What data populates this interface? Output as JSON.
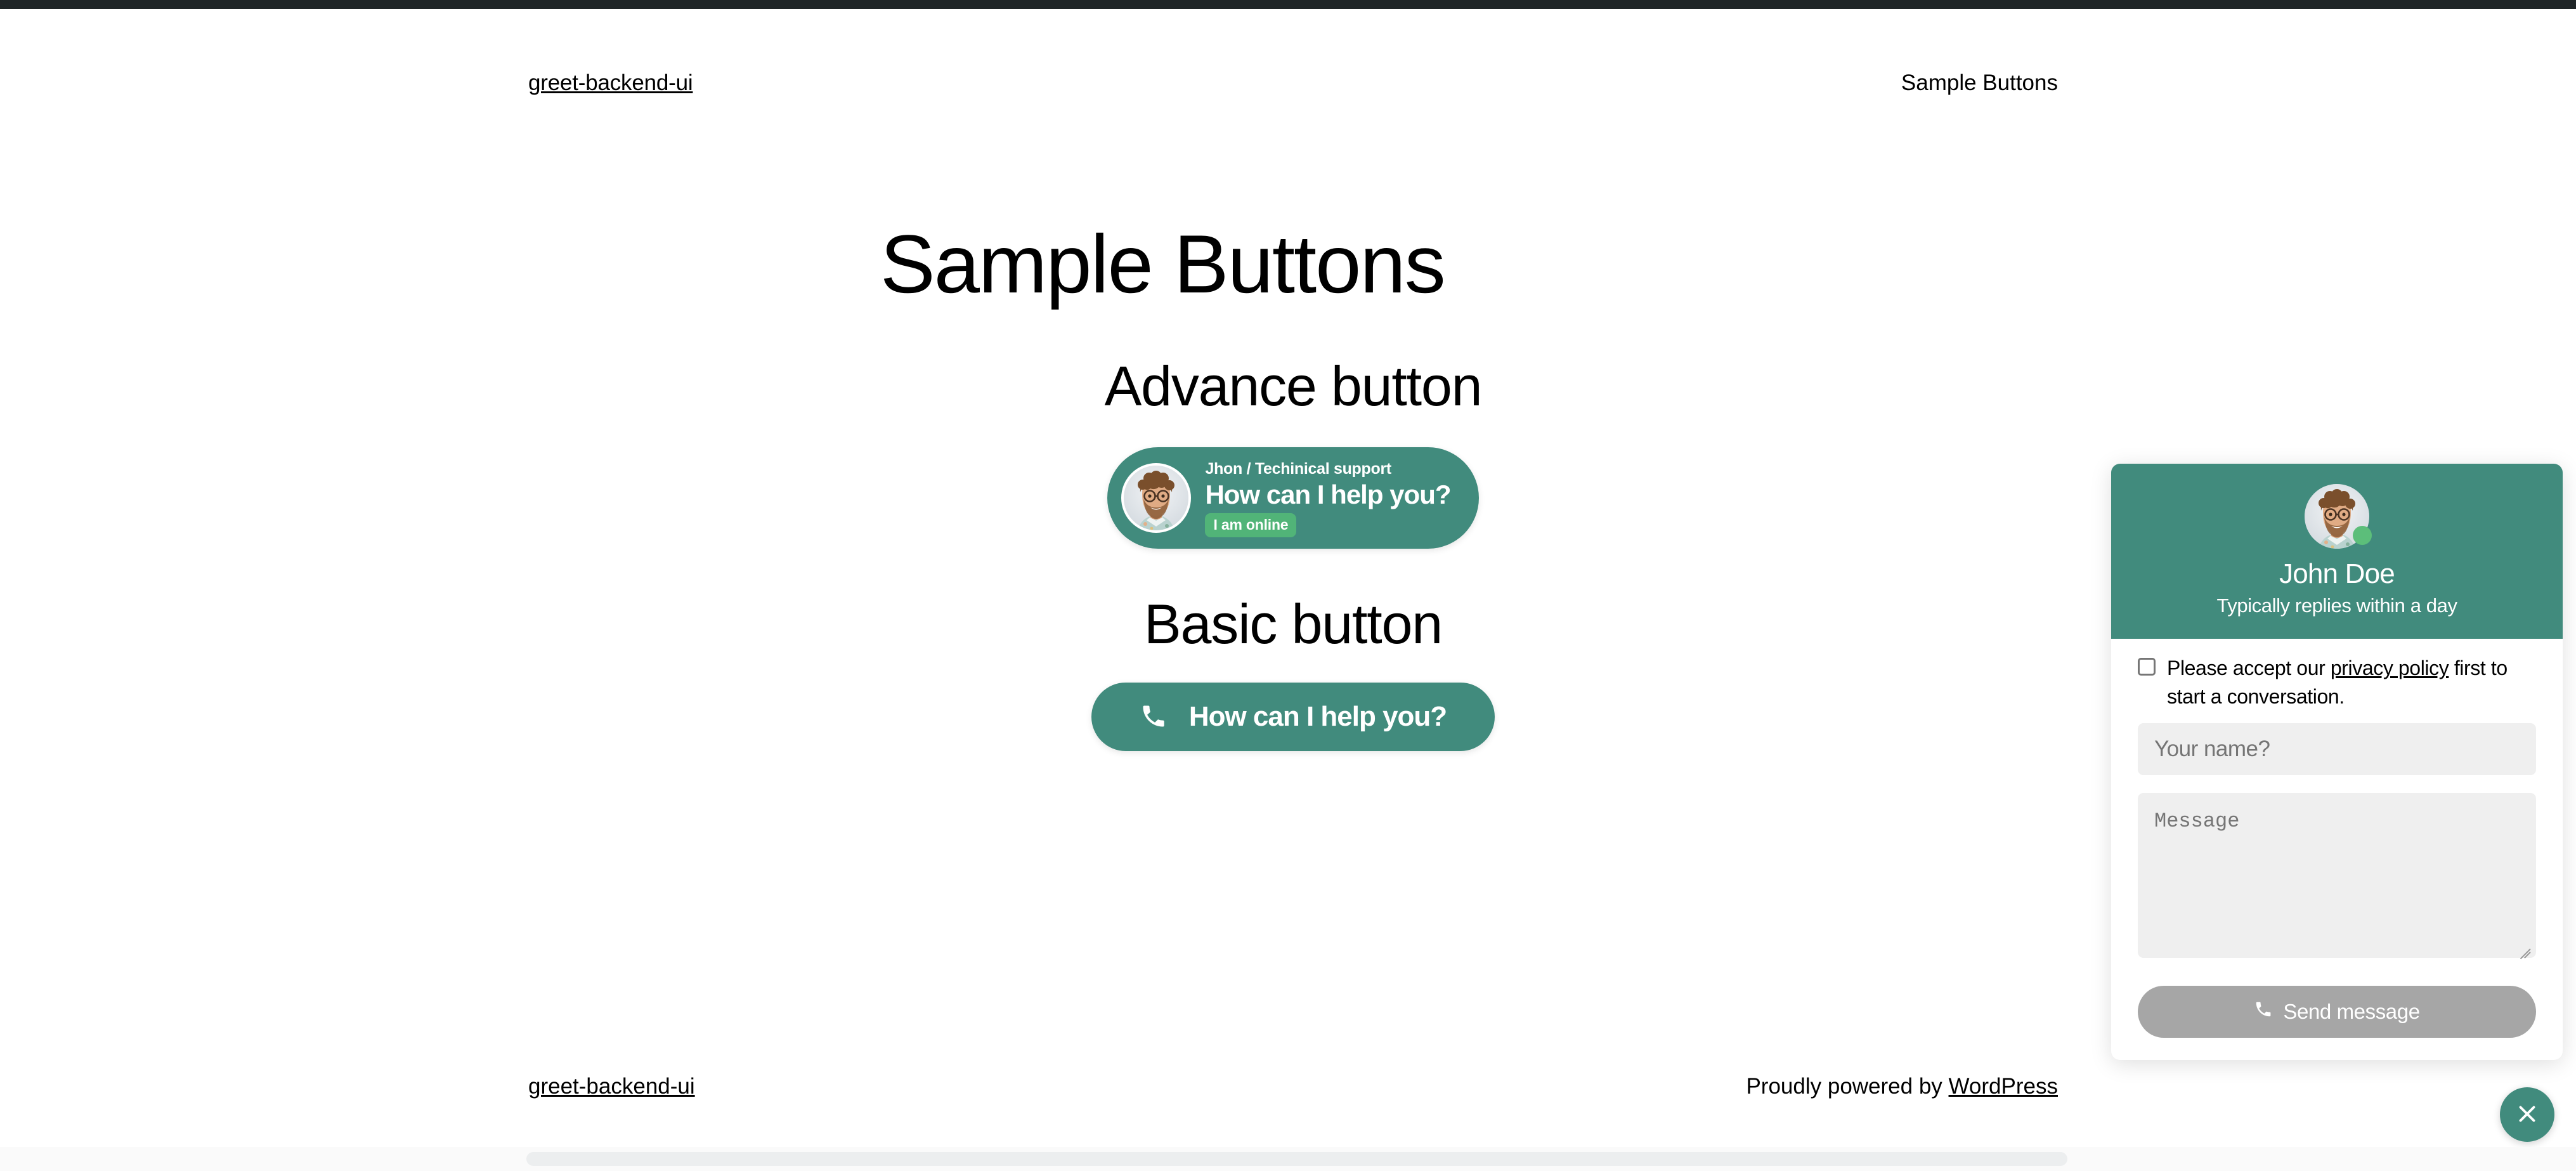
{
  "site": {
    "title": "greet-backend-ui",
    "nav_link": "Sample Buttons",
    "footer_title": "greet-backend-ui",
    "footer_credit_prefix": "Proudly powered by ",
    "footer_credit_link": "WordPress"
  },
  "main": {
    "page_title": "Sample Buttons",
    "sections": [
      {
        "heading": "Advance button"
      },
      {
        "heading": "Basic button"
      }
    ]
  },
  "advance_button": {
    "role": "Jhon / Techinical support",
    "message": "How can I help you?",
    "status_badge": "I am online",
    "avatar_icon": "agent-avatar-photo",
    "background_color": "#418b7d",
    "badge_color": "#51b478"
  },
  "basic_button": {
    "label": "How can I help you?",
    "icon": "phone-icon",
    "background_color": "#418b7d"
  },
  "chat_widget": {
    "agent_name": "John Doe",
    "agent_status": "Typically replies within a day",
    "avatar_icon": "agent-avatar-photo",
    "status_indicator": "online-dot",
    "header_color": "#418b7d",
    "consent": {
      "text_before": "Please accept our ",
      "link": "privacy policy",
      "text_after": " first to start a conversation.",
      "checked": false
    },
    "fields": {
      "name_placeholder": "Your name?",
      "name_value": "",
      "message_placeholder": "Message",
      "message_value": ""
    },
    "send_button": {
      "label": "Send message",
      "icon": "phone-icon",
      "disabled": true,
      "color": "#a6a6a6"
    }
  },
  "launcher": {
    "icon": "close-icon",
    "color": "#418b7d"
  }
}
